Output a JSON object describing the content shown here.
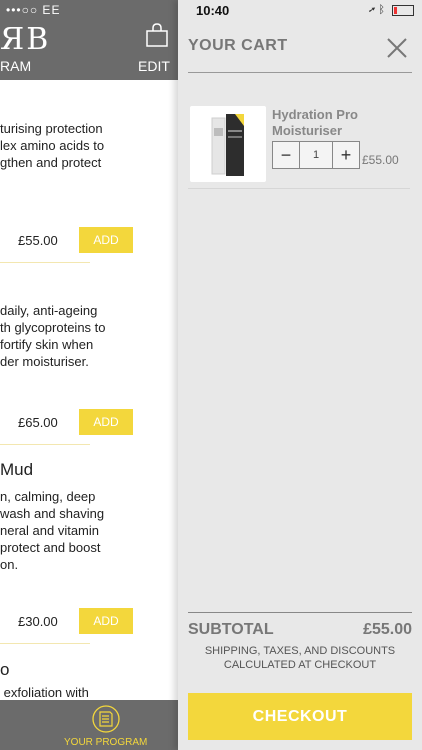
{
  "left_panel": {
    "status": "•••○○ EE",
    "logo": "ЯB",
    "program_label": "RAM",
    "edit_label": "EDIT",
    "products": [
      {
        "name": "",
        "desc": "turising protection\nlex amino acids to\ngthen and protect",
        "price": "£55.00",
        "add": "ADD"
      },
      {
        "name": "",
        "desc": "daily, anti-ageing\nth glycoproteins to\nfortify skin when\nder moisturiser.",
        "price": "£65.00",
        "add": "ADD"
      },
      {
        "name": "Mud",
        "desc": "n, calming, deep\nwash and shaving\nneral and vitamin\nprotect and boost\non.",
        "price": "£30.00",
        "add": "ADD"
      },
      {
        "name": "o",
        "desc": " exfoliation with"
      }
    ],
    "your_program": "YOUR PROGRAM"
  },
  "status_bar": {
    "time": "10:40"
  },
  "cart": {
    "title": "YOUR CART",
    "items": [
      {
        "name": "Hydration Pro Moisturiser",
        "quantity": "1",
        "price": "£55.00"
      }
    ],
    "subtotal_label": "SUBTOTAL",
    "subtotal_value": "£55.00",
    "shipping_note": "SHIPPING, TAXES, AND DISCOUNTS CALCULATED AT CHECKOUT",
    "checkout_label": "CHECKOUT"
  },
  "colors": {
    "accent": "#f3d73c",
    "header_gray": "#6b6b6b",
    "cart_bg": "#e8e8e8"
  }
}
